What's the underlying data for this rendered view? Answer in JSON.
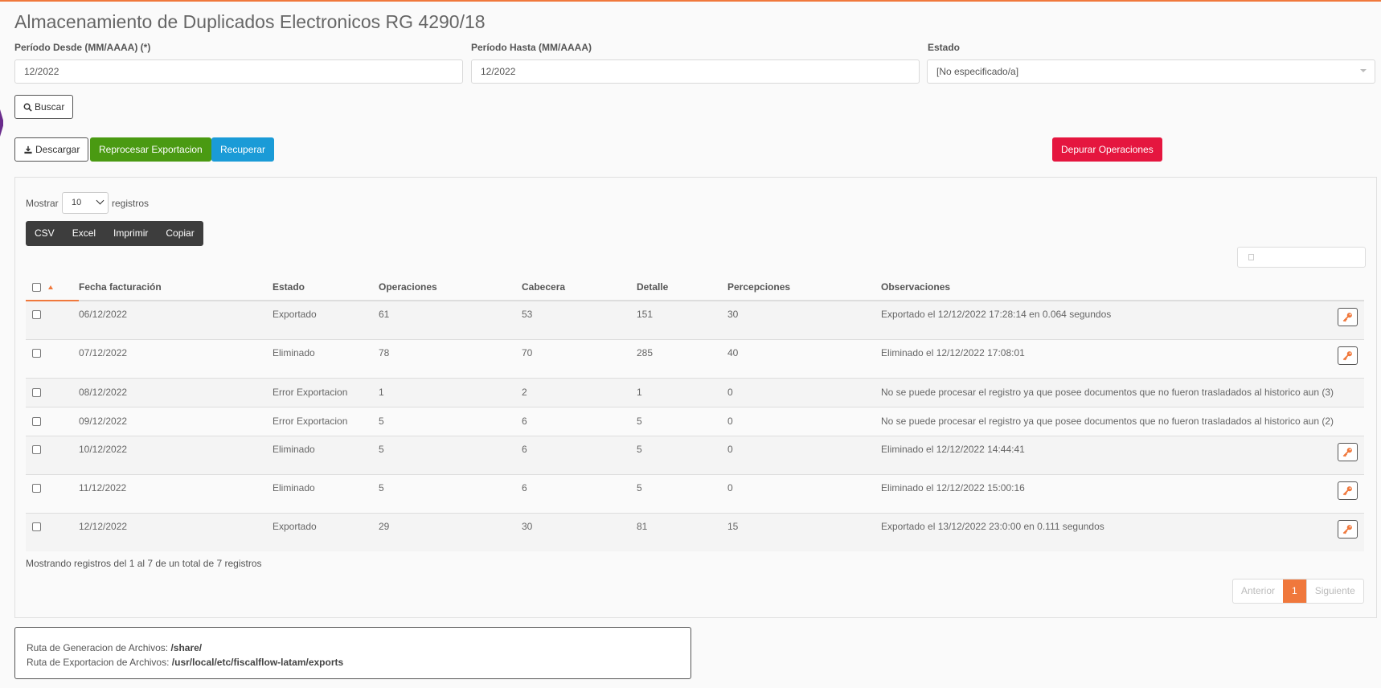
{
  "page": {
    "title": "Almacenamiento de Duplicados Electronicos RG 4290/18"
  },
  "filters": {
    "desde_label": "Período Desde (MM/AAAA) (*)",
    "desde_value": "12/2022",
    "hasta_label": "Período Hasta (MM/AAAA)",
    "hasta_value": "12/2022",
    "estado_label": "Estado",
    "estado_value": "[No especificado/a]",
    "buscar_label": "Buscar"
  },
  "actions": {
    "descargar": "Descargar",
    "reprocesar": "Reprocesar Exportacion",
    "recuperar": "Recuperar",
    "depurar": "Depurar Operaciones"
  },
  "colors": {
    "accent": "#f0783c",
    "green": "#4a9a12",
    "blue": "#1a9bd7",
    "red": "#e5163f"
  },
  "table_controls": {
    "mostrar": "Mostrar",
    "page_size": "10",
    "registros": "registros",
    "export_buttons": [
      "CSV",
      "Excel",
      "Imprimir",
      "Copiar"
    ]
  },
  "table": {
    "columns": [
      "Fecha facturación",
      "Estado",
      "Operaciones",
      "Cabecera",
      "Detalle",
      "Percepciones",
      "Observaciones"
    ],
    "rows": [
      {
        "fecha": "06/12/2022",
        "estado": "Exportado",
        "operaciones": "61",
        "cabecera": "53",
        "detalle": "151",
        "percepciones": "30",
        "observaciones": "Exportado el 12/12/2022 17:28:14 en 0.064 segundos",
        "action": "key-icon"
      },
      {
        "fecha": "07/12/2022",
        "estado": "Eliminado",
        "operaciones": "78",
        "cabecera": "70",
        "detalle": "285",
        "percepciones": "40",
        "observaciones": "Eliminado el 12/12/2022 17:08:01",
        "action": "key-icon"
      },
      {
        "fecha": "08/12/2022",
        "estado": "Error Exportacion",
        "operaciones": "1",
        "cabecera": "2",
        "detalle": "1",
        "percepciones": "0",
        "observaciones": "No se puede procesar el registro ya que posee documentos que no fueron trasladados al historico aun (3)",
        "action": ""
      },
      {
        "fecha": "09/12/2022",
        "estado": "Error Exportacion",
        "operaciones": "5",
        "cabecera": "6",
        "detalle": "5",
        "percepciones": "0",
        "observaciones": "No se puede procesar el registro ya que posee documentos que no fueron trasladados al historico aun (2)",
        "action": ""
      },
      {
        "fecha": "10/12/2022",
        "estado": "Eliminado",
        "operaciones": "5",
        "cabecera": "6",
        "detalle": "5",
        "percepciones": "0",
        "observaciones": "Eliminado el 12/12/2022 14:44:41",
        "action": "key-icon"
      },
      {
        "fecha": "11/12/2022",
        "estado": "Eliminado",
        "operaciones": "5",
        "cabecera": "6",
        "detalle": "5",
        "percepciones": "0",
        "observaciones": "Eliminado el 12/12/2022 15:00:16",
        "action": "key-icon"
      },
      {
        "fecha": "12/12/2022",
        "estado": "Exportado",
        "operaciones": "29",
        "cabecera": "30",
        "detalle": "81",
        "percepciones": "15",
        "observaciones": "Exportado el 13/12/2022 23:0:00 en 0.111 segundos",
        "action": "key-icon"
      }
    ]
  },
  "footer": {
    "info": "Mostrando registros del 1 al 7 de un total de 7 registros",
    "pager": {
      "prev": "Anterior",
      "current": "1",
      "next": "Siguiente"
    }
  },
  "paths": {
    "gen_label": "Ruta de Generacion de Archivos:",
    "gen_value": "/share/",
    "exp_label": "Ruta de Exportacion de Archivos:",
    "exp_value": "/usr/local/etc/fiscalflow-latam/exports"
  }
}
